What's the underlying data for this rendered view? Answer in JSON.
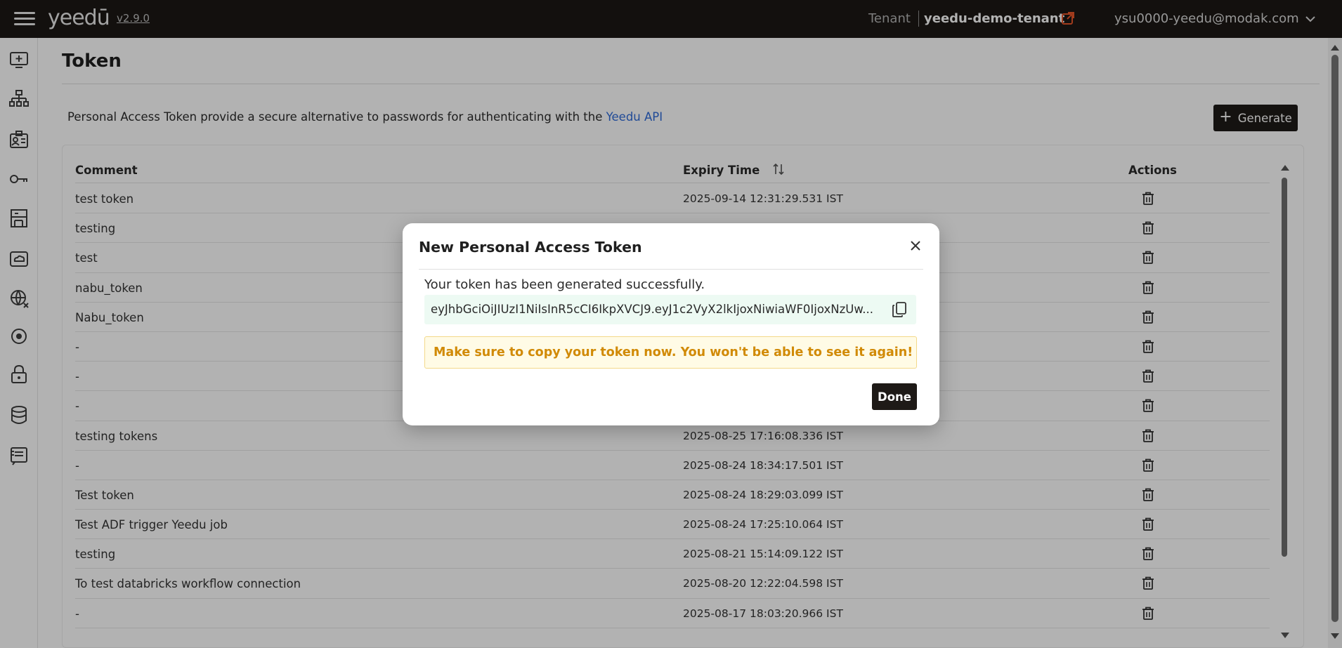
{
  "header": {
    "logo": "yeedū",
    "version": "v2.9.0",
    "tenant_label": "Tenant",
    "tenant_name": "yeedu-demo-tenant",
    "user_email": "ysu0000-yeedu@modak.com"
  },
  "sidebar": {
    "icons": [
      "monitor-plus-icon",
      "hierarchy-icon",
      "id-card-icon",
      "key-icon",
      "building-icon",
      "cloud-drive-icon",
      "globe-icon",
      "target-icon",
      "lock-icon",
      "database-icon",
      "notebook-icon"
    ]
  },
  "page": {
    "title": "Token",
    "intro_text": "Personal Access Token provide a secure alternative to passwords for authenticating with the ",
    "intro_link": "Yeedu API",
    "generate_label": "Generate"
  },
  "table": {
    "columns": [
      "Comment",
      "Expiry Time",
      "Actions"
    ],
    "rows": [
      {
        "comment": "test token",
        "expiry": "2025-09-14 12:31:29.531 IST"
      },
      {
        "comment": "testing",
        "expiry": ""
      },
      {
        "comment": "test",
        "expiry": ""
      },
      {
        "comment": "nabu_token",
        "expiry": ""
      },
      {
        "comment": "Nabu_token",
        "expiry": ""
      },
      {
        "comment": "-",
        "expiry": ""
      },
      {
        "comment": "-",
        "expiry": ""
      },
      {
        "comment": "-",
        "expiry": ""
      },
      {
        "comment": "testing tokens",
        "expiry": "2025-08-25 17:16:08.336 IST"
      },
      {
        "comment": "-",
        "expiry": "2025-08-24 18:34:17.501 IST"
      },
      {
        "comment": "Test token",
        "expiry": "2025-08-24 18:29:03.099 IST"
      },
      {
        "comment": "Test ADF trigger Yeedu job",
        "expiry": "2025-08-24 17:25:10.064 IST"
      },
      {
        "comment": "testing",
        "expiry": "2025-08-21 15:14:09.122 IST"
      },
      {
        "comment": "To test databricks workflow connection",
        "expiry": "2025-08-20 12:22:04.598 IST"
      },
      {
        "comment": "-",
        "expiry": "2025-08-17 18:03:20.966 IST"
      }
    ]
  },
  "modal": {
    "title": "New Personal Access Token",
    "success_text": "Your token has been generated successfully.",
    "token": "eyJhbGciOiJIUzI1NiIsInR5cCI6IkpXVCJ9.eyJ1c2VyX2lkIjoxNiwiaWF0IjoxNzUw...",
    "warning": "Make sure to copy your token now. You won't be able to see it again!",
    "done_label": "Done"
  },
  "colors": {
    "topbar": "#1c1815",
    "link": "#2f6bd8",
    "warning_text": "#d18a06",
    "warning_bg": "#fffbe6",
    "token_bg": "#edfaf3"
  }
}
